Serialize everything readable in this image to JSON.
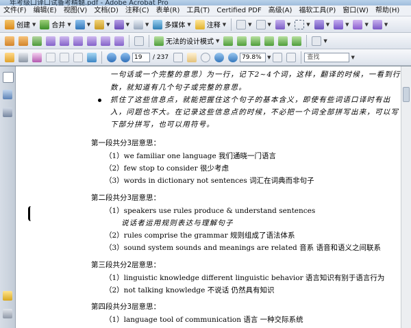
{
  "window": {
    "title": "年考级口译口试备考精髓.pdf - Adobe Acrobat Pro"
  },
  "menu": {
    "items": [
      "文件(F)",
      "编辑(E)",
      "视图(V)",
      "文档(D)",
      "注释(C)",
      "表单(R)",
      "工具(T)",
      "Certified PDF",
      "高级(A)",
      "福软工具(P)",
      "窗口(W)",
      "帮助(H)"
    ]
  },
  "toolbar1": {
    "create_label": "创建",
    "combine_label": "合并",
    "collaborate_label": "",
    "secure_label": "",
    "sign_label": "",
    "forms_label": "多媒体",
    "comment_label": "注释"
  },
  "toolbar2": {
    "design_mode_label": "无法的设计模式"
  },
  "toolbar3": {
    "page_current": "19",
    "page_total": "/ 237",
    "zoom_value": "79.8%",
    "find_placeholder": "查找"
  },
  "document": {
    "line1": "一句话或一个完整的意思）为一行，记下2~4个词，这样，翻译的时候，一看到行",
    "line2": "数，就知道有几个句子或完整的意思。",
    "line3": "抓住了这些信息点，就能把握住这个句子的基本含义，即使有些词语口译时有出",
    "line4": "入，问题也不大。在记录这些信息点的时候，不必把一个词全部拼写出来，可以写",
    "line5": "下部分拼写，也可以用符号。",
    "sec1_heading": "第一段共分3层意思：",
    "sec1_items": [
      "（1）we familiar one language 我们通晓一门语言",
      "（2）few stop to consider 很少考虑",
      "（3）words in dictionary not sentences 词汇在词典而非句子"
    ],
    "sec2_heading": "第二段共分3层意思：",
    "sec2_item1": "（1）speakers use rules produce & understand sentences",
    "sec2_item1_note": "说话者运用规则表达与理解句子",
    "sec2_item2": "（2）rules comprise the grammar 规则组成了语法体系",
    "sec2_item3": "（3）sound system    sounds and meanings are related 音系    语音和语义之间联系",
    "sec3_heading": "第三段共分2层意思：",
    "sec3_items": [
      "（1）linguistic knowledge different linguistic behavior 语言知识有别于语言行为",
      "（2）not talking    knowledge 不说话    仍然具有知识"
    ],
    "sec4_heading": "第四段共分3层意思：",
    "sec4_item1": "（1）language    tool of communication 语言    一种交际系统"
  },
  "colors": {
    "toolbar_top": "#f7f8fb",
    "toolbar_bottom": "#dde3ec",
    "page_bg": "#ffffff",
    "app_bg": "#7f8b95"
  },
  "icons": {
    "open": "folder-icon",
    "print": "printer-icon",
    "email": "email-icon",
    "prev": "arrow-up-icon",
    "next": "arrow-down-icon",
    "hand": "hand-icon",
    "zoom_in": "zoom-in-icon",
    "zoom_out": "zoom-out-icon"
  }
}
